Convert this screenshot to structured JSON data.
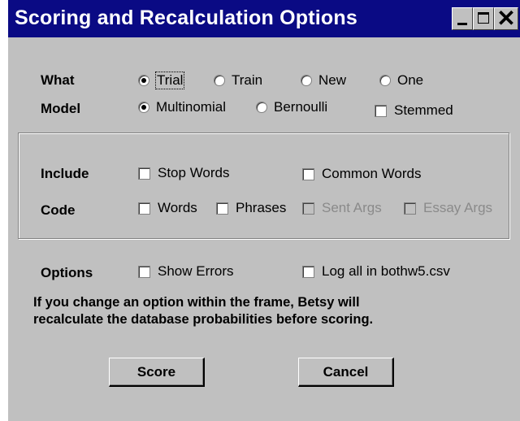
{
  "window": {
    "title": "Scoring and Recalculation Options"
  },
  "what": {
    "label": "What",
    "options": [
      "Trial",
      "Train",
      "New",
      "One"
    ],
    "selected": "Trial"
  },
  "model": {
    "label": "Model",
    "options": [
      "Multinomial",
      "Bernoulli"
    ],
    "selected": "Multinomial",
    "stemmed_label": "Stemmed",
    "stemmed_checked": false
  },
  "include": {
    "label": "Include",
    "stop_words": "Stop Words",
    "common_words": "Common Words"
  },
  "code": {
    "label": "Code",
    "words": "Words",
    "phrases": "Phrases",
    "sent_args": "Sent Args",
    "essay_args": "Essay Args"
  },
  "options": {
    "label": "Options",
    "show_errors": "Show Errors",
    "log_all": "Log all in bothw5.csv"
  },
  "note": {
    "line1": "If you change an option within the frame, Betsy will",
    "line2": "recalculate the database probabilities before scoring."
  },
  "buttons": {
    "score": "Score",
    "cancel": "Cancel"
  }
}
